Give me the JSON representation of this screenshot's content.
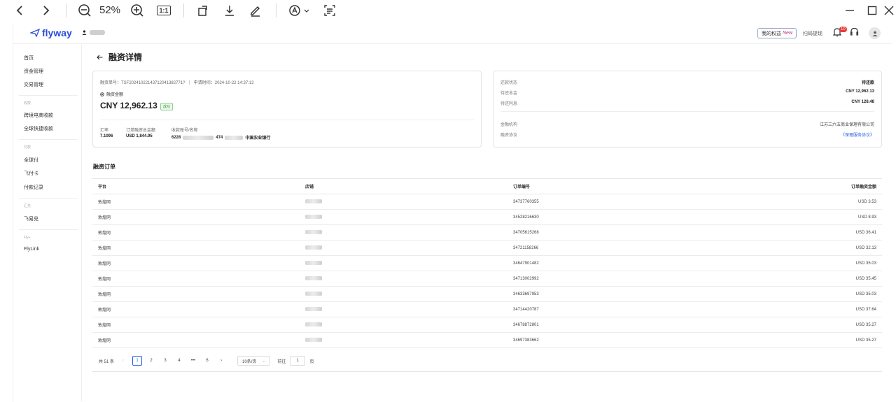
{
  "viewer": {
    "zoom": "52%",
    "one_to_one": "1:1"
  },
  "header": {
    "logo": "flyway",
    "rights_label": "我的权益",
    "rights_new": "New",
    "scan_label": "扫码提现",
    "notif_count": "10"
  },
  "sidebar": {
    "items_top": [
      "首页",
      "资金管理",
      "交易管理"
    ],
    "group_receive": "收款",
    "items_receive": [
      "跨境电商收款",
      "全球快捷收款"
    ],
    "group_pay": "付款",
    "items_pay": [
      "全球付",
      "飞付卡",
      "付款记录"
    ],
    "group_fx": "汇兑",
    "items_fx": [
      "飞易兑"
    ],
    "group_fly": "Fly+",
    "items_fly": [
      "FlyLink"
    ]
  },
  "page": {
    "title": "融资详情"
  },
  "summary": {
    "order_no_label": "融资单号：",
    "order_no": "TSF20241022143712041382771?",
    "apply_time_label": "申请时间：",
    "apply_time": "2024-10-22 14:37:13",
    "amount_label": "融资金额",
    "amount": "CNY 12,962.13",
    "status": "成功",
    "fx_label": "汇率",
    "fx_value": "7.1096",
    "order_total_label": "订单融资总金额",
    "order_total": "USD 1,844.95",
    "account_label": "收款账号/名称",
    "account_prefix": "6228",
    "account_mid": "474",
    "bank": "中国农业银行"
  },
  "repay": {
    "status_label": "还款状态",
    "status_value": "待还款",
    "principal_label": "待还本金",
    "principal_value": "CNY 12,962.13",
    "interest_label": "待还利息",
    "interest_value": "CNY 128.48",
    "institution_label": "金融机构",
    "institution_value": "江苏三六五商业保理有限公司",
    "agreement_label": "融资协议",
    "agreement_value": "《保理服务协议》"
  },
  "orders": {
    "title": "融资订单",
    "columns": [
      "平台",
      "店铺",
      "订单编号",
      "订单融资金额"
    ],
    "rows": [
      {
        "platform": "敦煌网",
        "order_no": "34737760355",
        "amount": "USD 3.53"
      },
      {
        "platform": "敦煌网",
        "order_no": "34528216630",
        "amount": "USD 8.93"
      },
      {
        "platform": "敦煌网",
        "order_no": "34705615268",
        "amount": "USD 36.41"
      },
      {
        "platform": "敦煌网",
        "order_no": "34721158266",
        "amount": "USD 32.13"
      },
      {
        "platform": "敦煌网",
        "order_no": "34647901482",
        "amount": "USD 35.03"
      },
      {
        "platform": "敦煌网",
        "order_no": "34713002992",
        "amount": "USD 35.45"
      },
      {
        "platform": "敦煌网",
        "order_no": "34633697953",
        "amount": "USD 35.03"
      },
      {
        "platform": "敦煌网",
        "order_no": "34714420787",
        "amount": "USD 37.64"
      },
      {
        "platform": "敦煌网",
        "order_no": "34678872801",
        "amount": "USD 35.27"
      },
      {
        "platform": "敦煌网",
        "order_no": "34697383662",
        "amount": "USD 35.27"
      }
    ]
  },
  "pagination": {
    "total": "共 51 条",
    "pages": [
      "1",
      "2",
      "3",
      "4",
      "•••",
      "6"
    ],
    "page_size": "10条/页",
    "goto_label": "前往",
    "goto_value": "1",
    "goto_suffix": "页"
  }
}
